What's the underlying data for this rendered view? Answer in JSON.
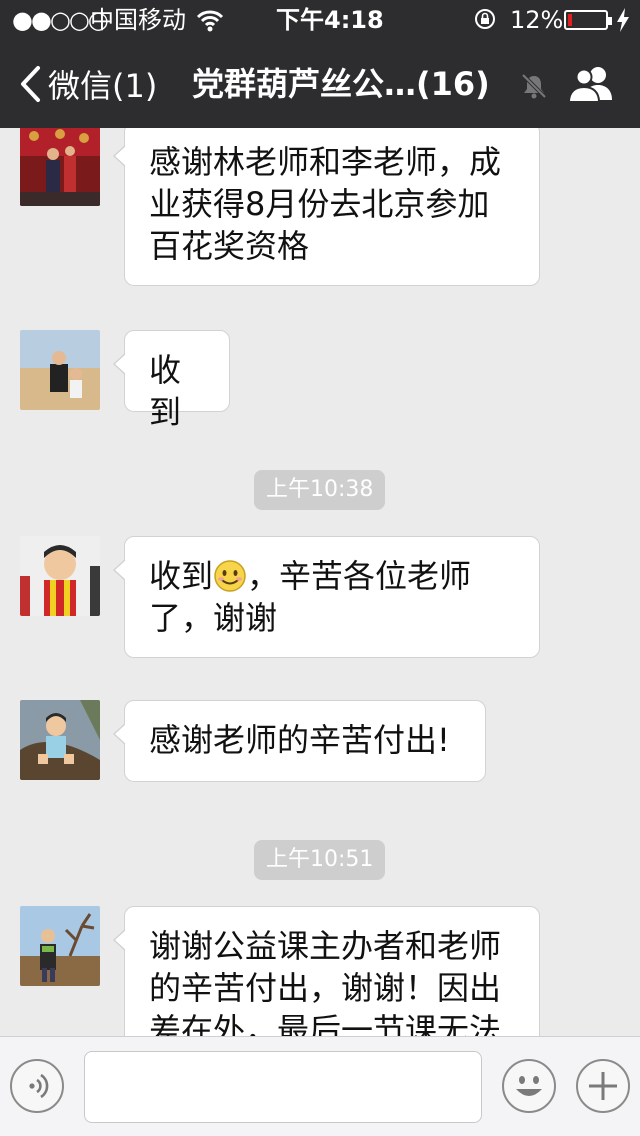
{
  "status_bar": {
    "signal": "●●○○○",
    "carrier": "中国移动",
    "time": "下午4:18",
    "battery_percent": "12%",
    "battery_level": 0.12,
    "battery_color": "#e02020"
  },
  "nav": {
    "back_label": "微信(1)",
    "title": "党群葫芦丝公…(16)"
  },
  "messages": [
    {
      "text": "感谢林老师和李老师，成业获得8月份去北京参加百花奖资格"
    },
    {
      "text": "收到"
    },
    {
      "timestamp": "上午10:38"
    },
    {
      "text_before": "收到",
      "text_after": "，辛苦各位老师了，谢谢",
      "emoji": "smile-emoji"
    },
    {
      "text": "感谢老师的辛苦付出!"
    },
    {
      "timestamp": "上午10:51"
    },
    {
      "text": "谢谢公益课主办者和老师的辛苦付出，谢谢！因出差在外，最后一节课无法"
    }
  ],
  "colors": {
    "header_bg": "#2d2d2f",
    "chat_bg": "#ebebeb",
    "bubble_bg": "#ffffff",
    "timestamp_bg": "#cecece"
  }
}
